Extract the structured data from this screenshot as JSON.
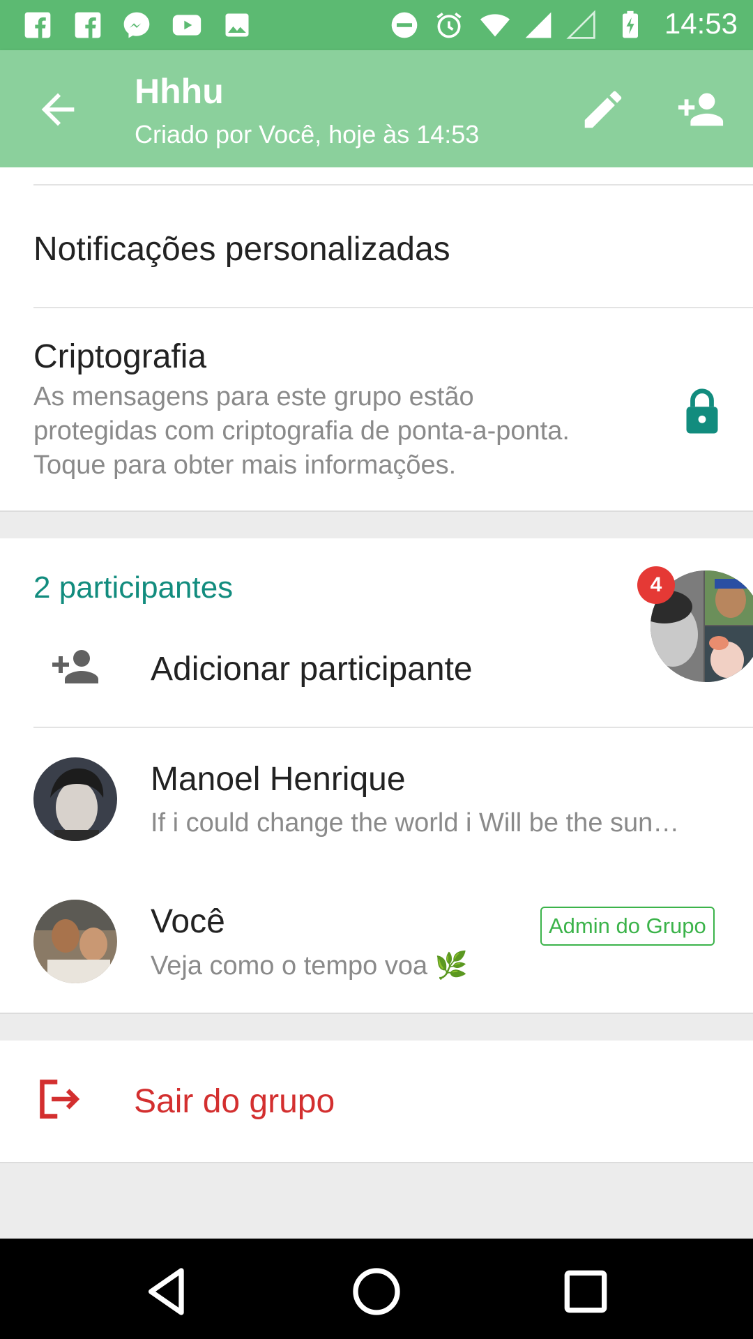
{
  "status_bar": {
    "time": "14:53",
    "left_icons": [
      "facebook-icon",
      "facebook-icon",
      "messenger-icon",
      "youtube-icon",
      "image-icon"
    ],
    "right_icons": [
      "do-not-disturb-icon",
      "alarm-icon",
      "wifi-icon",
      "signal-icon",
      "signal-empty-icon",
      "battery-charging-icon"
    ]
  },
  "app_bar": {
    "title": "Hhhu",
    "subtitle": "Criado por Você, hoje às 14:53",
    "background": "#8bd09c"
  },
  "settings": {
    "custom_notifications": "Notificações personalizadas",
    "encryption": {
      "title": "Criptografia",
      "line1": "As mensagens para este grupo estão",
      "line2": "protegidas com criptografia de ponta-a-ponta.",
      "line3": "Toque para obter mais informações."
    }
  },
  "participants": {
    "header": "2 participantes",
    "add_label": "Adicionar participante",
    "chat_head_badge": "4",
    "list": [
      {
        "name": "Manoel Henrique",
        "status": "If i could change the world i Will be the sun…"
      },
      {
        "name": "Você",
        "status": "Veja como o tempo voa 🌿",
        "badge": "Admin do Grupo"
      }
    ]
  },
  "exit": {
    "label": "Sair do grupo"
  },
  "colors": {
    "accent_teal": "#128c7e",
    "admin_green": "#3bb34a",
    "exit_red": "#d32f2f",
    "status_bar": "#5cba72"
  }
}
